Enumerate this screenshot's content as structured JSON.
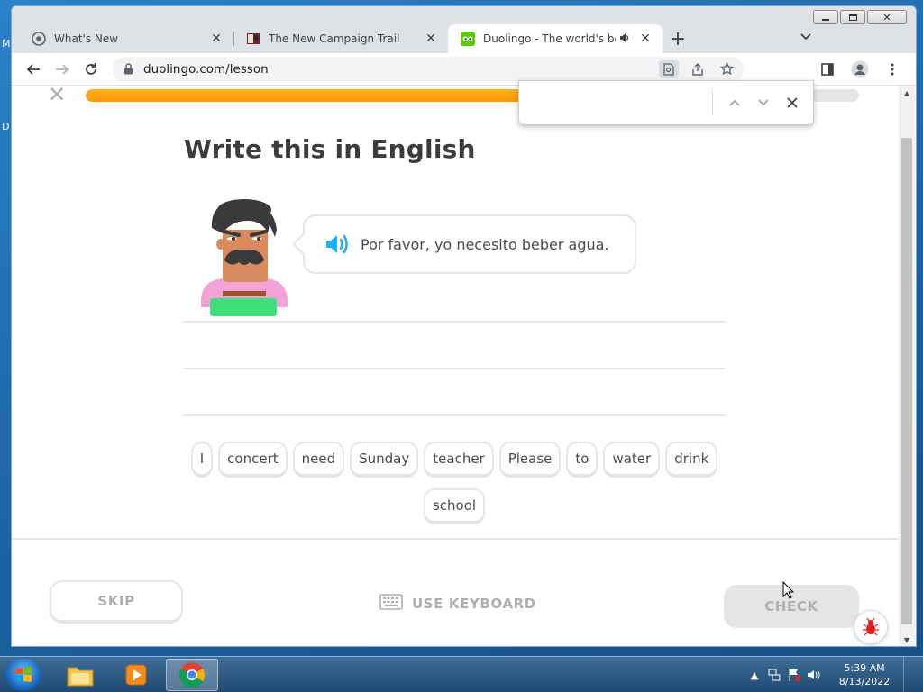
{
  "desktop": {
    "icon_labels": [
      "M",
      "D"
    ]
  },
  "browser": {
    "tabs": [
      {
        "title": "What's New",
        "favicon": "chrome-icon"
      },
      {
        "title": "The New Campaign Trail",
        "favicon": "campaign-trail-icon"
      },
      {
        "title": "Duolingo - The world's best way to learn a language",
        "favicon": "duolingo-icon",
        "audio": true,
        "active": true
      }
    ],
    "url": "duolingo.com/lesson",
    "find_bar": {
      "query": "",
      "placeholder": ""
    }
  },
  "lesson": {
    "progress_fraction": 0.58,
    "instruction": "Write this in English",
    "sentence": "Por favor, yo necesito beber agua.",
    "word_bank": [
      "I",
      "concert",
      "need",
      "Sunday",
      "teacher",
      "Please",
      "to",
      "water",
      "drink",
      "school"
    ],
    "skip_label": "SKIP",
    "keyboard_label": "USE KEYBOARD",
    "check_label": "CHECK"
  },
  "taskbar": {
    "time": "5:39 AM",
    "date": "8/13/2022"
  },
  "colors": {
    "progress": "#ff9600",
    "speaker": "#1cb0f6",
    "disabled_text": "#afafaf",
    "border": "#e5e5e5"
  }
}
